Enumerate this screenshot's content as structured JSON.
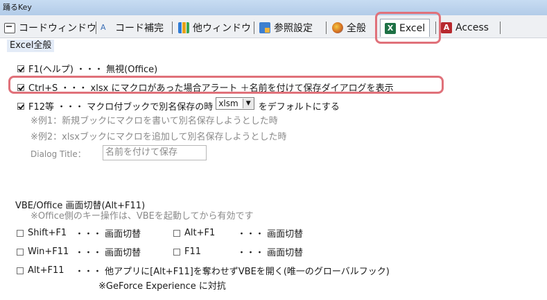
{
  "window": {
    "title": "踊るKey"
  },
  "tabs": [
    {
      "label": "コードウィンドウ",
      "icon": "code-window-icon"
    },
    {
      "label": "コード補完",
      "icon": "code-completion-icon"
    },
    {
      "label": "他ウィンドウ",
      "icon": "other-window-icon"
    },
    {
      "label": "参照設定",
      "icon": "references-icon"
    },
    {
      "label": "全般",
      "icon": "general-icon"
    },
    {
      "label": "Excel",
      "icon": "excel-icon",
      "active": true
    },
    {
      "label": "Access",
      "icon": "access-icon"
    }
  ],
  "section": {
    "title": "Excel全般"
  },
  "options": {
    "f1": {
      "label": "F1(ヘルプ) ・・・ 無視(Office)",
      "checked": true
    },
    "ctrl_s": {
      "label": "Ctrl+S ・・・ xlsx にマクロがあった場合アラート ＋名前を付けて保存ダイアログを表示",
      "checked": true
    },
    "f12": {
      "label_before": "F12等 ・・・ マクロ付ブックで別名保存の時",
      "select_value": "xlsm",
      "label_after": "をデフォルトにする",
      "checked": true
    },
    "example1": "※例1：新規ブックにマクロを書いて別名保存しようとした時",
    "example2": "※例2：xlsxブックにマクロを追加して別名保存しようとした時",
    "dialog_title_label": "Dialog Title：",
    "dialog_title_placeholder": "名前を付けて保存"
  },
  "vbe": {
    "title": "VBE/Office 画面切替(Alt+F11)",
    "note": "※Office側のキー操作は、VBEを起動してから有効です",
    "items": [
      {
        "key": "Shift+F1",
        "action": "・・・ 画面切替",
        "checked": false
      },
      {
        "key": "Alt+F1",
        "action": "・・・ 画面切替",
        "checked": false
      },
      {
        "key": "Win+F11",
        "action": "・・・ 画面切替",
        "checked": false
      },
      {
        "key": "F11",
        "action": "・・・ 画面切替",
        "checked": false
      },
      {
        "key": "Alt+F11",
        "action": "・・・ 他アプリに[Alt+F11]を奪わせずVBEを開く(唯一のグローバルフック)",
        "checked": false
      }
    ],
    "footnote": "※GeForce Experience に対抗"
  },
  "colors": {
    "highlight": "#e0717a",
    "excel": "#1e7145",
    "access": "#b7282e"
  }
}
